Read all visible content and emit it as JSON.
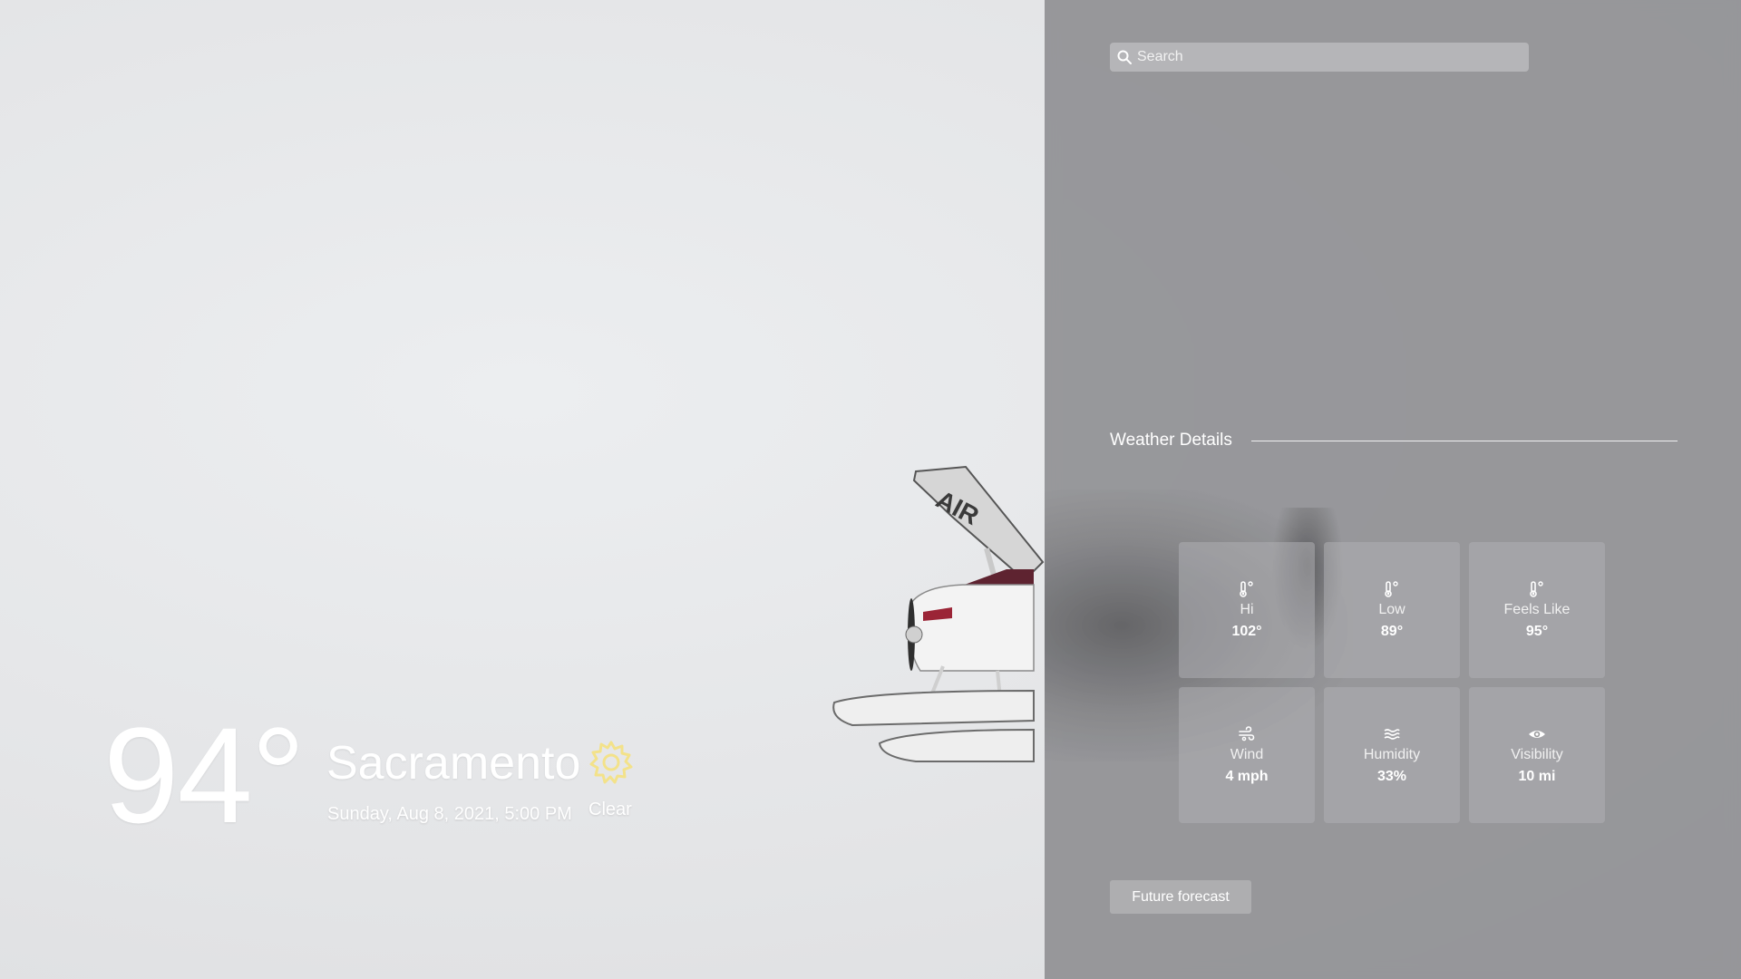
{
  "weather": {
    "temperature": "94°",
    "city": "Sacramento",
    "datetime": "Sunday, Aug 8, 2021, 5:00 PM",
    "condition": "Clear",
    "condition_icon": "sun-icon"
  },
  "search": {
    "placeholder": "Search",
    "icon": "search-icon"
  },
  "details": {
    "title": "Weather Details",
    "tiles": [
      {
        "label": "Hi",
        "value": "102°",
        "icon": "thermometer-icon"
      },
      {
        "label": "Low",
        "value": "89°",
        "icon": "thermometer-icon"
      },
      {
        "label": "Feels Like",
        "value": "95°",
        "icon": "thermometer-icon"
      },
      {
        "label": "Wind",
        "value": "4 mph",
        "icon": "wind-icon"
      },
      {
        "label": "Humidity",
        "value": "33%",
        "icon": "humidity-icon"
      },
      {
        "label": "Visibility",
        "value": "10 mi",
        "icon": "eye-icon"
      }
    ]
  },
  "forecast_button": {
    "label": "Future forecast"
  },
  "colors": {
    "accent_sun": "#f3e28a",
    "text": "#ffffff",
    "panel": "#8c8c8f"
  }
}
